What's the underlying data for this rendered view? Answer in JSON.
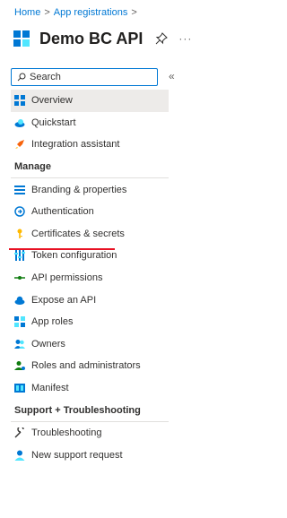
{
  "breadcrumb": {
    "items": [
      "Home",
      "App registrations"
    ],
    "separator": ">"
  },
  "header": {
    "title": "Demo BC API",
    "more": "···"
  },
  "search": {
    "placeholder": "Search",
    "collapse_glyph": "«"
  },
  "nav": {
    "overview": "Overview",
    "quickstart": "Quickstart",
    "integration": "Integration assistant",
    "manage_header": "Manage",
    "branding": "Branding & properties",
    "authentication": "Authentication",
    "certificates": "Certificates & secrets",
    "token": "Token configuration",
    "api_permissions": "API permissions",
    "expose_api": "Expose an API",
    "app_roles": "App roles",
    "owners": "Owners",
    "roles_admins": "Roles and administrators",
    "manifest": "Manifest",
    "support_header": "Support + Troubleshooting",
    "troubleshooting": "Troubleshooting",
    "new_support": "New support request"
  },
  "colors": {
    "accent": "#0078d4",
    "selected_bg": "#edebe9",
    "highlight_underline": "#e81123"
  }
}
